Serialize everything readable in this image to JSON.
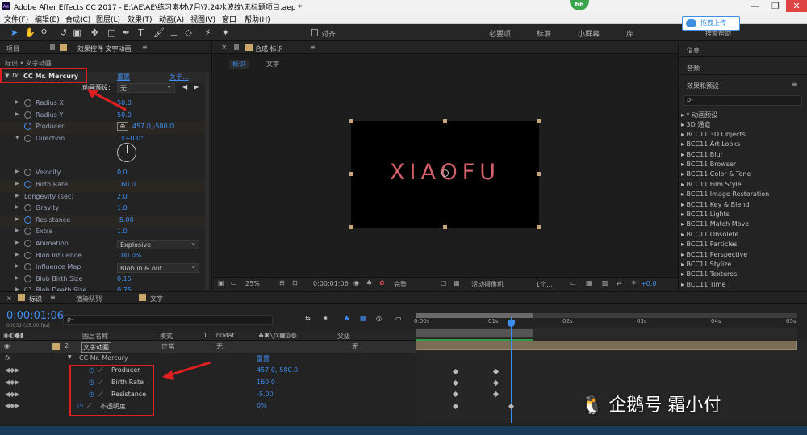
{
  "window": {
    "app_badge": "Ae",
    "title": "Adobe After Effects CC 2017 - E:\\AE\\AE\\练习素材\\7月\\7.24水波纹\\无标题项目.aep *",
    "badge": "66",
    "controls": [
      "—",
      "❐",
      "✕"
    ]
  },
  "menu": [
    "文件(F)",
    "编辑(E)",
    "合成(C)",
    "图层(L)",
    "效果(T)",
    "动画(A)",
    "视图(V)",
    "窗口",
    "帮助(H)"
  ],
  "toolbar": {
    "snap_label": "对齐",
    "workspaces": [
      "必要项",
      "标准",
      "小屏幕",
      "库"
    ],
    "cloud_upload": "拖拽上传",
    "search_help": "搜索帮助"
  },
  "effect_controls": {
    "tab_project": "项目",
    "tab_effect": "效果控件 文字动画",
    "breadcrumb": "标识 • 文字动画",
    "fx": "fx",
    "effect_name": "CC Mr. Mercury",
    "reset": "重置",
    "about": "关于...",
    "preset_label": "动画预设:",
    "preset_value": "无",
    "properties": [
      {
        "name": "Radius X",
        "value": "50.0"
      },
      {
        "name": "Radius Y",
        "value": "50.0"
      },
      {
        "name": "Producer",
        "value": "457.0,-580.0"
      },
      {
        "name": "Direction",
        "value": "1x+0.0°"
      },
      {
        "name": "Velocity",
        "value": "0.0"
      },
      {
        "name": "Birth Rate",
        "value": "160.0"
      },
      {
        "name": "Longevity (sec)",
        "value": "2.0"
      },
      {
        "name": "Gravity",
        "value": "1.0"
      },
      {
        "name": "Resistance",
        "value": "-5.00"
      },
      {
        "name": "Extra",
        "value": "1.0"
      },
      {
        "name": "Animation",
        "value": "Explosive"
      },
      {
        "name": "Blob Influence",
        "value": "100.0%"
      },
      {
        "name": "Influence Map",
        "value": "Blob in & out"
      },
      {
        "name": "Blob Birth Size",
        "value": "0.15"
      },
      {
        "name": "Blob Death Size",
        "value": "0.75"
      }
    ]
  },
  "composition": {
    "tab_label": "合成 标识",
    "tab_active": "标识",
    "tab_other": "文字",
    "text": "XIAOFU",
    "zoom": "25%",
    "timecode": "0:00:01:06",
    "quality": "完整",
    "camera": "活动摄像机",
    "views": "1个...",
    "exposure": "+0.0"
  },
  "right_panel": {
    "info": "信息",
    "audio": "音频",
    "effects_title": "效果和预设",
    "search_placeholder": "ρ-",
    "items": [
      "▸ * 动画预设",
      "▸ 3D 通道",
      "▸ BCC11 3D Objects",
      "▸ BCC11 Art Looks",
      "▸ BCC11 Blur",
      "▸ BCC11 Browser",
      "▸ BCC11 Color & Tone",
      "▸ BCC11 Film Style",
      "▸ BCC11 Image Restoration",
      "▸ BCC11 Key & Blend",
      "▸ BCC11 Lights",
      "▸ BCC11 Match Move",
      "▸ BCC11 Obsolete",
      "▸ BCC11 Particles",
      "▸ BCC11 Perspective",
      "▸ BCC11 Stylize",
      "▸ BCC11 Textures",
      "▸ BCC11 Time"
    ]
  },
  "timeline": {
    "tab_active": "标识",
    "tab_render": "渲染队列",
    "tab_text": "文字",
    "timecode": "0:00:01:06",
    "fps": "00031 (25.00 fps)",
    "search_placeholder": "ρ-",
    "col_layer_name": "图层名称",
    "col_mode": "模式",
    "col_t": "T",
    "col_trkmat": "TrkMat",
    "col_parent": "父级",
    "layer_num": "2",
    "layer_name": "文字动画",
    "layer_mode": "正常",
    "layer_trkmat": "无",
    "layer_parent": "无",
    "effect_group": "CC Mr. Mercury",
    "effect_reset": "重置",
    "rows": [
      {
        "name": "Producer",
        "value": "457.0,-580.0"
      },
      {
        "name": "Birth Rate",
        "value": "160.0"
      },
      {
        "name": "Resistance",
        "value": "-5.00"
      },
      {
        "name": "不透明度",
        "value": "0%"
      }
    ],
    "ruler": [
      "0:00s",
      "01s",
      "02s",
      "03s",
      "04s",
      "05s"
    ]
  },
  "watermark": "企鹅号 霜小付"
}
